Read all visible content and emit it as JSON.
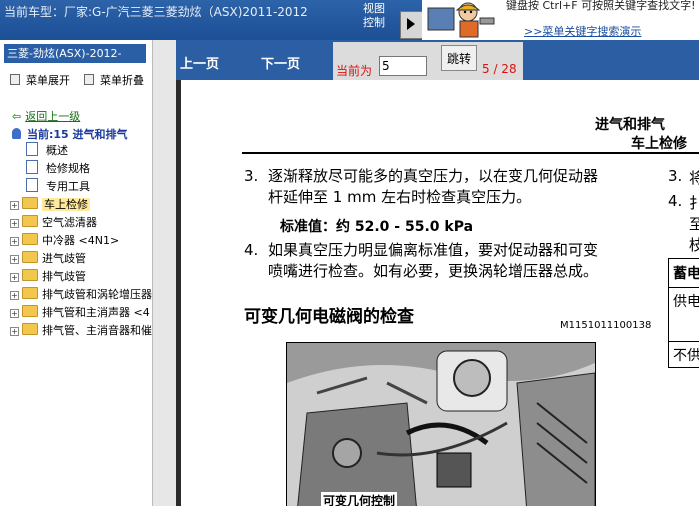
{
  "header": {
    "vehicle_title": "当前车型：厂家:G-广汽三菱三菱劲炫（ASX)2011-2012",
    "view_control_label": "视图控制",
    "tip_text": "键盘按 Ctrl+F 可按照关键字查找文字!",
    "tip_link": ">>菜单关键字搜索演示"
  },
  "sidebar": {
    "title": "三菱-劲炫(ASX)-2012-",
    "expand_label": "菜单展开",
    "collapse_label": "菜单折叠",
    "back_label": "返回上一级",
    "current_label": "当前:15 进气和排气",
    "docs": [
      "概述",
      "检修规格",
      "专用工具"
    ],
    "folders": [
      "车上检修",
      "空气滤清器",
      "中冷器 <4N1>",
      "进气歧管",
      "排气歧管",
      "排气歧管和涡轮增压器",
      "排气管和主消声器 <4",
      "排气管、主消音器和催"
    ],
    "selected_folder": "车上检修"
  },
  "navbar": {
    "prev_label": "上一页",
    "next_label": "下一页",
    "current_page_label": "当前为",
    "page_value": "5",
    "go_label": "跳转",
    "page_count": "5 / 28"
  },
  "document": {
    "title": "进气和排气",
    "subtitle": "车上检修",
    "step3_num": "3.",
    "step3_text_line1": "逐渐释放尽可能多的真空压力，以在变几何促动器",
    "step3_text_line2": "杆延伸至 1 mm 左右时检查真空压力。",
    "standard_value": "标准值：约 52.0 - 55.0 kPa",
    "step4_num": "4.",
    "step4_text_line1": "如果真空压力明显偏离标准值，要对促动器和可变",
    "step4_text_line2": "喷嘴进行检查。如有必要，更换涡轮增压器总成。",
    "section_title": "可变几何电磁阀的检查",
    "figure_id": "M1151011100138",
    "photo_caption": "可变几何控制",
    "right_col": {
      "n3": "3.",
      "t3": "将",
      "n4": "4.",
      "t4a": "扌",
      "t4b": "至",
      "t4c": "枝",
      "table_header": "蓄电",
      "table_row1": "供电",
      "table_row2": "不供"
    }
  }
}
